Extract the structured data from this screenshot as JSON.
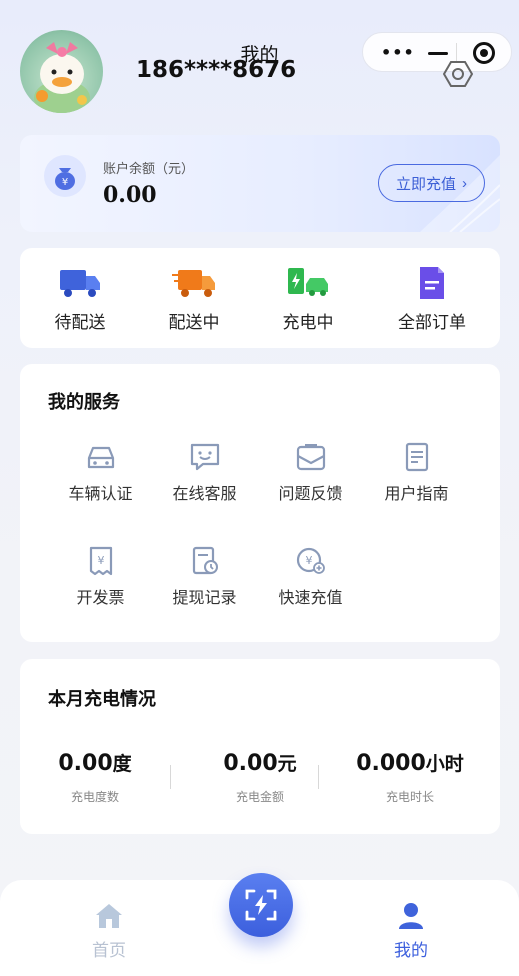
{
  "header": {
    "title": "我的",
    "phone": "186****8676"
  },
  "balance": {
    "label": "账户余额（元）",
    "value": "0.00",
    "button": "立即充值"
  },
  "orders": [
    "待配送",
    "配送中",
    "充电中",
    "全部订单"
  ],
  "services": {
    "title": "我的服务",
    "items": [
      "车辆认证",
      "在线客服",
      "问题反馈",
      "用户指南",
      "开发票",
      "提现记录",
      "快速充值"
    ]
  },
  "stats": {
    "title": "本月充电情况",
    "items": [
      {
        "value": "0.00",
        "unit": "度",
        "label": "充电度数"
      },
      {
        "value": "0.00",
        "unit": "元",
        "label": "充电金额"
      },
      {
        "value": "0.000",
        "unit": "小时",
        "label": "充电时长"
      }
    ]
  },
  "tabbar": {
    "home": "首页",
    "mine": "我的"
  },
  "colors": {
    "accent": "#3c5fdd",
    "orange": "#f07a1a",
    "green": "#2fb84f",
    "purple": "#6a4ee8"
  }
}
